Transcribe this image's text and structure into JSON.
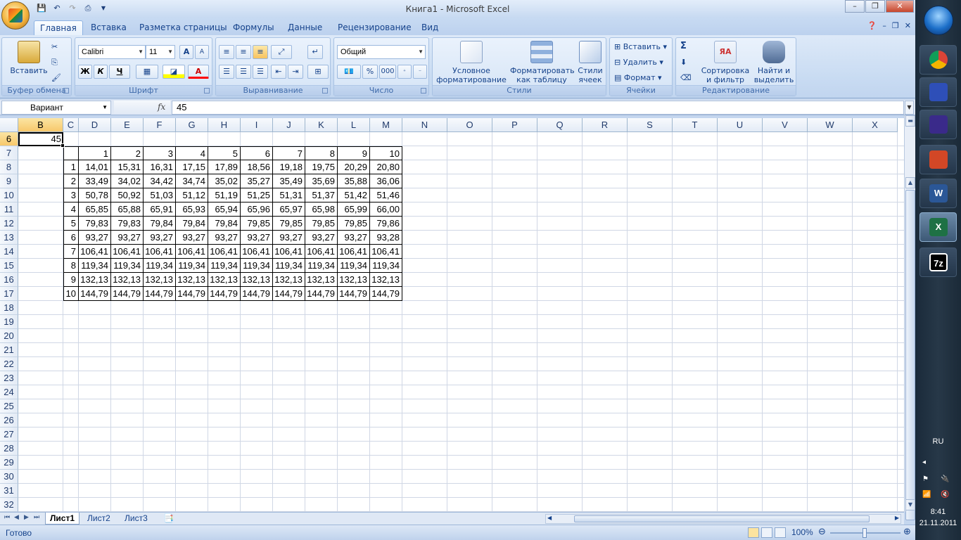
{
  "window": {
    "title": "Книга1 - Microsoft Excel",
    "controls": {
      "minimize": "–",
      "restore": "❐",
      "close": "✕"
    }
  },
  "tabs": [
    "Главная",
    "Вставка",
    "Разметка страницы",
    "Формулы",
    "Данные",
    "Рецензирование",
    "Вид"
  ],
  "ribbon": {
    "clipboard": {
      "paste": "Вставить",
      "label": "Буфер обмена"
    },
    "font": {
      "name": "Calibri",
      "size": "11",
      "bold": "Ж",
      "italic": "К",
      "underline": "Ч",
      "grow": "A",
      "shrink": "A",
      "font_color": "A",
      "label": "Шрифт"
    },
    "alignment": {
      "label": "Выравнивание"
    },
    "number": {
      "format": "Общий",
      "percent": "%",
      "thousands": "000",
      "label": "Число"
    },
    "styles": {
      "conditional": "Условное форматирование",
      "as_table": "Форматировать как таблицу",
      "cell_styles": "Стили ячеек",
      "label": "Стили"
    },
    "cells": {
      "insert": "Вставить",
      "delete": "Удалить",
      "format": "Формат",
      "label": "Ячейки"
    },
    "editing": {
      "sum": "Σ",
      "sort": "Сортировка и фильтр",
      "find": "Найти и выделить",
      "label": "Редактирование"
    }
  },
  "formula_bar": {
    "name_box": "Вариант",
    "fx": "fx",
    "value": "45"
  },
  "columns": [
    "B",
    "C",
    "D",
    "E",
    "F",
    "G",
    "H",
    "I",
    "J",
    "K",
    "L",
    "M",
    "N",
    "O",
    "P",
    "Q",
    "R",
    "S",
    "T",
    "U",
    "V",
    "W",
    "X"
  ],
  "rows": [
    "6",
    "7",
    "8",
    "9",
    "10",
    "11",
    "12",
    "13",
    "14",
    "15",
    "16",
    "17",
    "18",
    "19",
    "20",
    "21",
    "22",
    "23",
    "24",
    "25",
    "26",
    "27",
    "28",
    "29",
    "30",
    "31",
    "32"
  ],
  "variant_value": "45",
  "table": {
    "header": [
      "1",
      "2",
      "3",
      "4",
      "5",
      "6",
      "7",
      "8",
      "9",
      "10"
    ],
    "row_labels": [
      "1",
      "2",
      "3",
      "4",
      "5",
      "6",
      "7",
      "8",
      "9",
      "10"
    ],
    "values": [
      [
        "14,01",
        "15,31",
        "16,31",
        "17,15",
        "17,89",
        "18,56",
        "19,18",
        "19,75",
        "20,29",
        "20,80"
      ],
      [
        "33,49",
        "34,02",
        "34,42",
        "34,74",
        "35,02",
        "35,27",
        "35,49",
        "35,69",
        "35,88",
        "36,06"
      ],
      [
        "50,78",
        "50,92",
        "51,03",
        "51,12",
        "51,19",
        "51,25",
        "51,31",
        "51,37",
        "51,42",
        "51,46"
      ],
      [
        "65,85",
        "65,88",
        "65,91",
        "65,93",
        "65,94",
        "65,96",
        "65,97",
        "65,98",
        "65,99",
        "66,00"
      ],
      [
        "79,83",
        "79,83",
        "79,84",
        "79,84",
        "79,84",
        "79,85",
        "79,85",
        "79,85",
        "79,85",
        "79,86"
      ],
      [
        "93,27",
        "93,27",
        "93,27",
        "93,27",
        "93,27",
        "93,27",
        "93,27",
        "93,27",
        "93,27",
        "93,28"
      ],
      [
        "106,41",
        "106,41",
        "106,41",
        "106,41",
        "106,41",
        "106,41",
        "106,41",
        "106,41",
        "106,41",
        "106,41"
      ],
      [
        "119,34",
        "119,34",
        "119,34",
        "119,34",
        "119,34",
        "119,34",
        "119,34",
        "119,34",
        "119,34",
        "119,34"
      ],
      [
        "132,13",
        "132,13",
        "132,13",
        "132,13",
        "132,13",
        "132,13",
        "132,13",
        "132,13",
        "132,13",
        "132,13"
      ],
      [
        "144,79",
        "144,79",
        "144,79",
        "144,79",
        "144,79",
        "144,79",
        "144,79",
        "144,79",
        "144,79",
        "144,79"
      ]
    ]
  },
  "sheets": [
    "Лист1",
    "Лист2",
    "Лист3"
  ],
  "status": {
    "ready": "Готово",
    "zoom": "100%"
  },
  "taskbar": {
    "apps": [
      "chrome-icon",
      "save-icon",
      "app-icon",
      "powerpoint-icon",
      "word-icon",
      "excel-icon",
      "7zip-icon"
    ],
    "word_glyph": "W",
    "excel_glyph": "X",
    "zip_glyph": "7z",
    "lang": "RU",
    "time": "8:41",
    "date": "21.11.2011"
  }
}
